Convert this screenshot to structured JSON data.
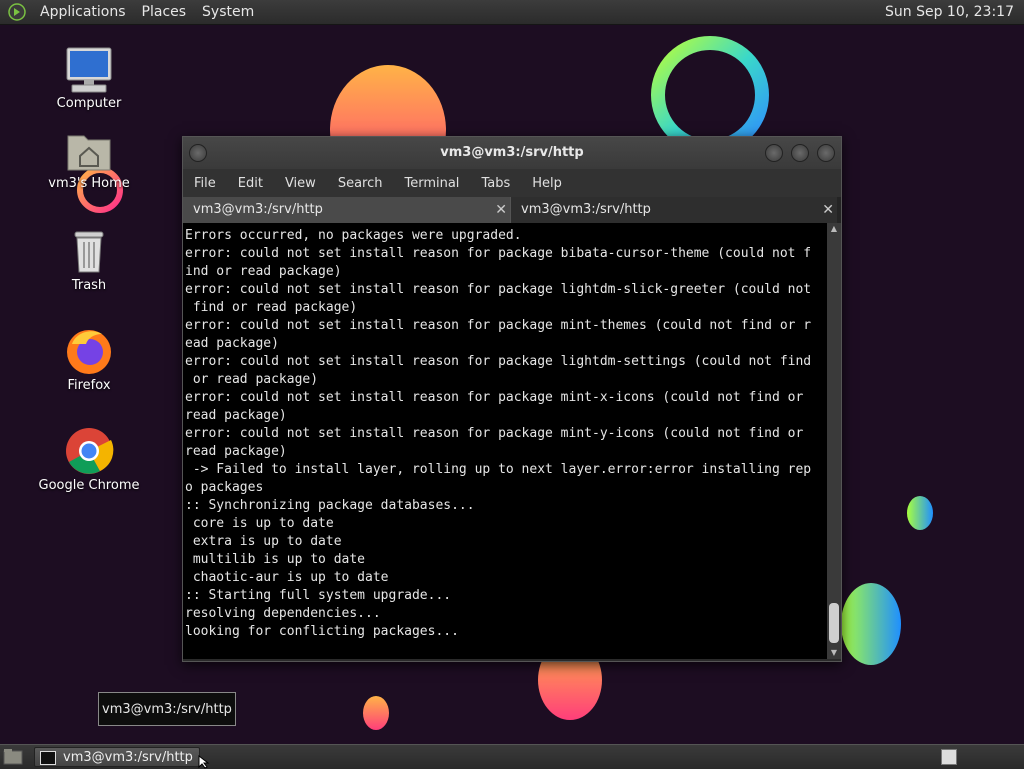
{
  "top_panel": {
    "menus": [
      "Applications",
      "Places",
      "System"
    ],
    "clock": "Sun Sep 10, 23:17"
  },
  "desktop_icons": [
    {
      "label": "Computer",
      "icon": "computer-icon"
    },
    {
      "label": "vm3's Home",
      "icon": "home-folder-icon"
    },
    {
      "label": "Trash",
      "icon": "trash-icon"
    },
    {
      "label": "Firefox",
      "icon": "firefox-icon"
    },
    {
      "label": "Google Chrome",
      "icon": "chrome-icon"
    }
  ],
  "terminal": {
    "title": "vm3@vm3:/srv/http",
    "menu": [
      "File",
      "Edit",
      "View",
      "Search",
      "Terminal",
      "Tabs",
      "Help"
    ],
    "tabs": [
      {
        "label": "vm3@vm3:/srv/http",
        "active": false
      },
      {
        "label": "vm3@vm3:/srv/http",
        "active": true
      }
    ],
    "lines": [
      "Errors occurred, no packages were upgraded.",
      "error: could not set install reason for package bibata-cursor-theme (could not f",
      "ind or read package)",
      "error: could not set install reason for package lightdm-slick-greeter (could not",
      " find or read package)",
      "error: could not set install reason for package mint-themes (could not find or r",
      "ead package)",
      "error: could not set install reason for package lightdm-settings (could not find",
      " or read package)",
      "error: could not set install reason for package mint-x-icons (could not find or",
      "read package)",
      "error: could not set install reason for package mint-y-icons (could not find or",
      "read package)",
      " -> Failed to install layer, rolling up to next layer.error:error installing rep",
      "o packages",
      ":: Synchronizing package databases...",
      " core is up to date",
      " extra is up to date",
      " multilib is up to date",
      " chaotic-aur is up to date",
      ":: Starting full system upgrade...",
      "resolving dependencies...",
      "looking for conflicting packages..."
    ]
  },
  "tooltip": "vm3@vm3:/srv/http",
  "taskbar": {
    "task_label": "vm3@vm3:/srv/http"
  },
  "colors": {
    "wallpaper": "#1d0d22",
    "terminal_bg": "#000000",
    "terminal_fg": "#e6e6e6"
  }
}
